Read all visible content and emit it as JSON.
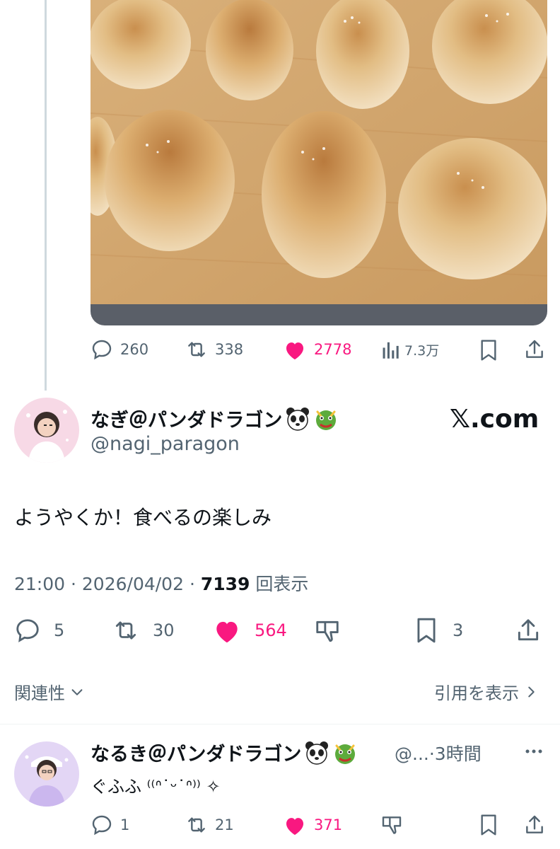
{
  "quoted_tweet": {
    "actions": {
      "replies": "260",
      "retweets": "338",
      "likes": "2778",
      "views": "7.3万"
    }
  },
  "main_tweet": {
    "author_name": "なぎ＠パンダドラゴン",
    "author_handle": "@nagi_paragon",
    "watermark": "𝕏.com",
    "text": "ようやくか！食べるの楽しみ",
    "time": "21:00",
    "date": "2026/04/02",
    "views_count": "7139",
    "views_label": "回表示",
    "actions": {
      "replies": "5",
      "retweets": "30",
      "likes": "564",
      "bookmarks": "3"
    }
  },
  "context_bar": {
    "related_label": "関連性",
    "quotes_label": "引用を表示"
  },
  "reply": {
    "author_name": "なるき＠パンダドラゴン",
    "author_handle": "@...",
    "time_ago": "3時間",
    "text": "ぐふふ  ⁽⁽ᐢ˙ᵕ˙ᐢ⁾⁾ ✧",
    "actions": {
      "replies": "1",
      "retweets": "21",
      "likes": "371"
    }
  },
  "colors": {
    "like_pink": "#f91880",
    "secondary_text": "#536471",
    "primary_text": "#0f1419"
  }
}
